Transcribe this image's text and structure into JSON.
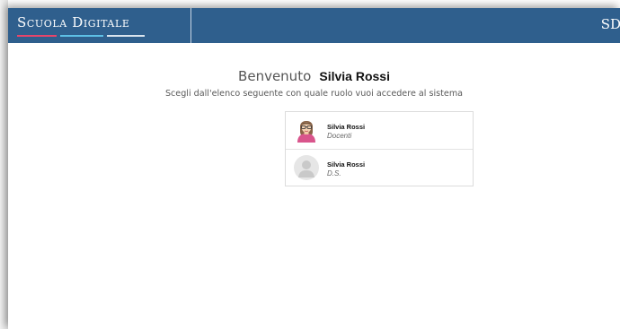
{
  "header": {
    "brand": "Scuola Digitale",
    "corner_mark": "SD",
    "colors": {
      "bar": "#2f5f8d",
      "line_pink": "#e7456b",
      "line_blue": "#5ec0e6",
      "line_light": "#d9e4ee"
    }
  },
  "welcome": {
    "greeting": "Benvenuto",
    "user_name": "Silvia Rossi",
    "instructions": "Scegli dall'elenco seguente con quale ruolo vuoi accedere al sistema"
  },
  "roles": [
    {
      "name": "Silvia Rossi",
      "role": "Docenti",
      "avatar": "teacher-avatar-icon"
    },
    {
      "name": "Silvia Rossi",
      "role": "D.S.",
      "avatar": "default-user-avatar-icon"
    }
  ]
}
